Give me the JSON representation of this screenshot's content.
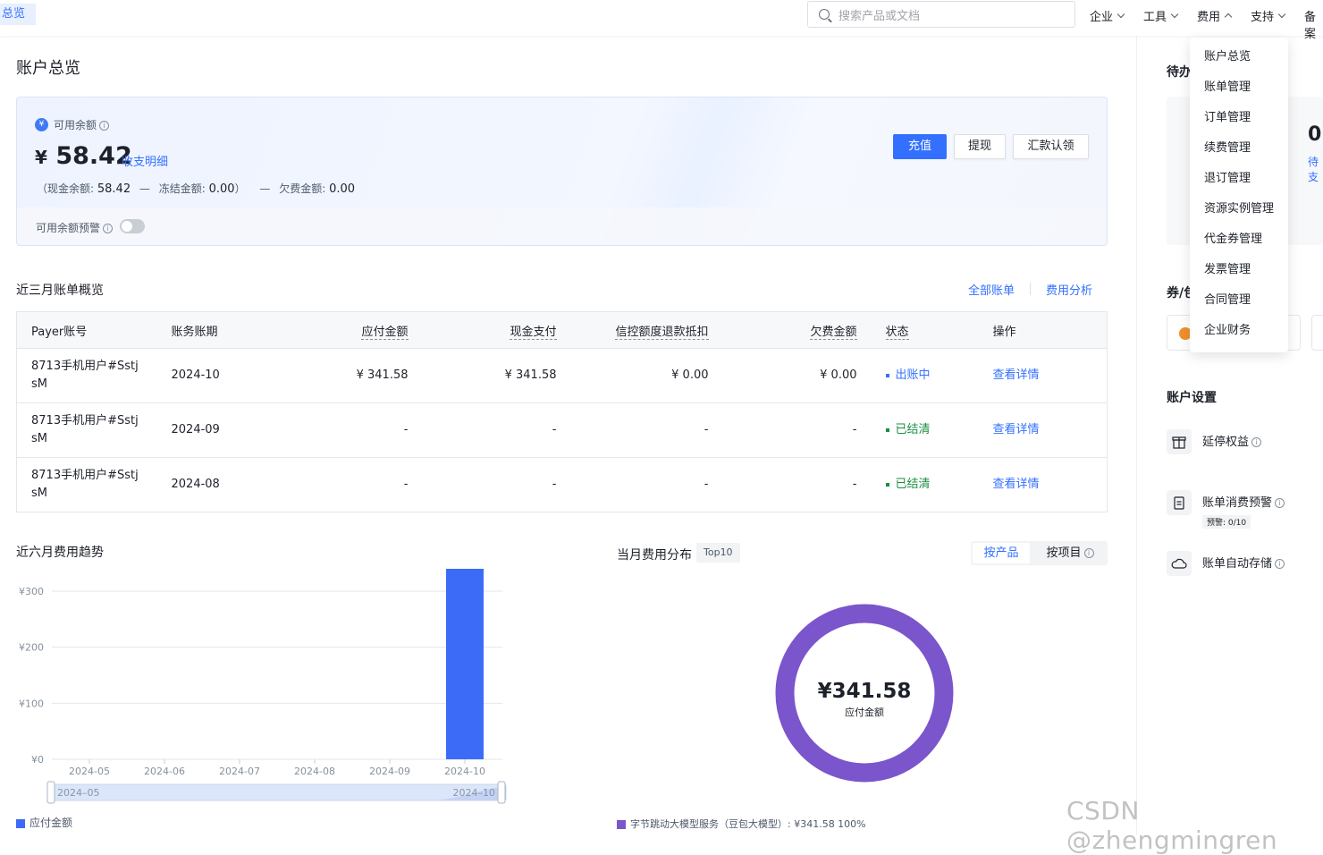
{
  "nav": {
    "active_tab": "总览",
    "search_placeholder": "搜索产品或文档",
    "items": [
      "企业",
      "工具",
      "费用",
      "支持",
      "备案"
    ]
  },
  "dropdown": {
    "items": [
      "账户总览",
      "账单管理",
      "订单管理",
      "续费管理",
      "退订管理",
      "资源实例管理",
      "代金券管理",
      "发票管理",
      "合同管理",
      "企业财务"
    ]
  },
  "page_title": "账户总览",
  "balance": {
    "label": "可用余额",
    "badge": "¥",
    "currency": "¥",
    "amount": "58.42",
    "detail_link": "收支明细",
    "breakdown_open": "（现金余额:",
    "cash": "58.42",
    "sep": "—",
    "frozen_label": "冻结金额:",
    "frozen": "0.00",
    "close": "）",
    "owed_label": "欠费金额:",
    "owed": "0.00",
    "alert_label": "可用余额预警",
    "buttons": {
      "recharge": "充值",
      "withdraw": "提现",
      "remit": "汇款认领"
    }
  },
  "bills": {
    "title": "近三月账单概览",
    "links": {
      "all": "全部账单",
      "analysis": "费用分析"
    },
    "columns": [
      "Payer账号",
      "账务账期",
      "应付金额",
      "现金支付",
      "信控额度退款抵扣",
      "欠费金额",
      "状态",
      "操作"
    ],
    "rows": [
      {
        "account": "8713手机用户#SstjsM",
        "period": "2024-10",
        "payable": "¥ 341.58",
        "cash": "¥ 341.58",
        "credit": "¥ 0.00",
        "owed": "¥ 0.00",
        "status": "出账中",
        "action": "查看详情"
      },
      {
        "account": "8713手机用户#SstjsM",
        "period": "2024-09",
        "payable": "-",
        "cash": "-",
        "credit": "-",
        "owed": "-",
        "status": "已结清",
        "action": "查看详情"
      },
      {
        "account": "8713手机用户#SstjsM",
        "period": "2024-08",
        "payable": "-",
        "cash": "-",
        "credit": "-",
        "owed": "-",
        "status": "已结清",
        "action": "查看详情"
      }
    ],
    "status_colors": {
      "出账中": "#3370ff",
      "已结清": "#1a8f3e"
    }
  },
  "trend": {
    "title": "近六月费用趋势",
    "legend": "应付金额",
    "slider_start": "2024–05",
    "slider_end": "2024–10"
  },
  "distribution": {
    "title": "当月费用分布",
    "badge": "Top10",
    "seg_product": "按产品",
    "seg_project": "按项目",
    "center_value": "¥341.58",
    "center_label": "应付金额",
    "legend": "字节跳动大模型服务（豆包大模型）: ¥341.58 100%"
  },
  "right_panel": {
    "todo_title": "待办",
    "todo_count": "0",
    "todo_sub": "待支",
    "voucher_title": "券/包",
    "settings_title": "账户设置",
    "settings": [
      {
        "label": "延停权益",
        "icon": "gift-icon"
      },
      {
        "label": "账单消费预警",
        "icon": "clipboard-icon",
        "sub": "预警: 0/10"
      },
      {
        "label": "账单自动存储",
        "icon": "cloud-storage-icon"
      }
    ]
  },
  "watermark": "CSDN @zhengmingren",
  "chart_data": [
    {
      "type": "bar",
      "categories": [
        "2024-05",
        "2024-06",
        "2024-07",
        "2024-08",
        "2024-09",
        "2024-10"
      ],
      "series": [
        {
          "name": "应付金额",
          "values": [
            0,
            0,
            0,
            0,
            0,
            341.58
          ]
        }
      ],
      "yticks": [
        "¥0",
        "¥100",
        "¥200",
        "¥300"
      ],
      "ylim": [
        0,
        300
      ],
      "grid": true,
      "legend": "bottom-left",
      "color": "#3c6cf7"
    },
    {
      "type": "pie",
      "donut": true,
      "labels": [
        "字节跳动大模型服务（豆包大模型）"
      ],
      "values": [
        341.58
      ],
      "percent": [
        100
      ],
      "color": "#7a55cc"
    }
  ]
}
